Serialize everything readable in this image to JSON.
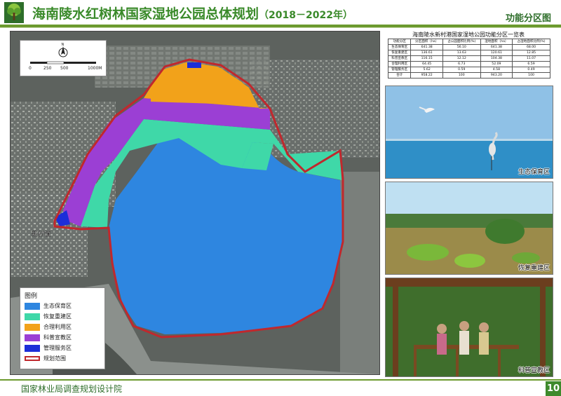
{
  "header": {
    "title": "海南陵水红树林国家湿地公园总体规划",
    "years": "（2018－2022年）",
    "section": "功能分区图"
  },
  "map": {
    "north_label": "N",
    "scale_ticks": [
      "0",
      "250",
      "500",
      "1000M"
    ],
    "town_label": "新村镇",
    "legend_title": "图例",
    "legend": [
      {
        "label": "生态保育区",
        "color": "#2e86e0"
      },
      {
        "label": "恢复重建区",
        "color": "#3fd8a8"
      },
      {
        "label": "合理利用区",
        "color": "#f2a21a"
      },
      {
        "label": "科普宣教区",
        "color": "#9b3fd4"
      },
      {
        "label": "管理服务区",
        "color": "#1c2ed8"
      },
      {
        "label": "规划范围",
        "color": "#c0282d"
      }
    ]
  },
  "table": {
    "title": "海南陵水新村港国家湿地公园功能分区一览表",
    "headers": [
      "功能分区",
      "分区面积（ha）",
      "占公园面积比例(%)",
      "湿地面积（ha）",
      "占湿地面积比例(%)"
    ],
    "rows": [
      [
        "生态保育区",
        "641.38",
        "56.10",
        "641.38",
        "68.00"
      ],
      [
        "恢复重建区",
        "136.61",
        "13.63",
        "120.61",
        "12.85"
      ],
      [
        "科普宣教区",
        "116.15",
        "12.12",
        "104.38",
        "11.07"
      ],
      [
        "合理利用区",
        "64.45",
        "6.73",
        "52.09",
        "6.59"
      ],
      [
        "管理服务区",
        "5.62",
        "0.59",
        "4.58",
        "0.49"
      ],
      [
        "合计",
        "958.22",
        "100",
        "943.20",
        "100"
      ]
    ]
  },
  "photos": [
    {
      "caption": "生态保育区"
    },
    {
      "caption": "恢复重建区"
    },
    {
      "caption": "科普宣教区"
    }
  ],
  "footer": {
    "org": "国家林业局调查规划设计院",
    "page": "10"
  }
}
